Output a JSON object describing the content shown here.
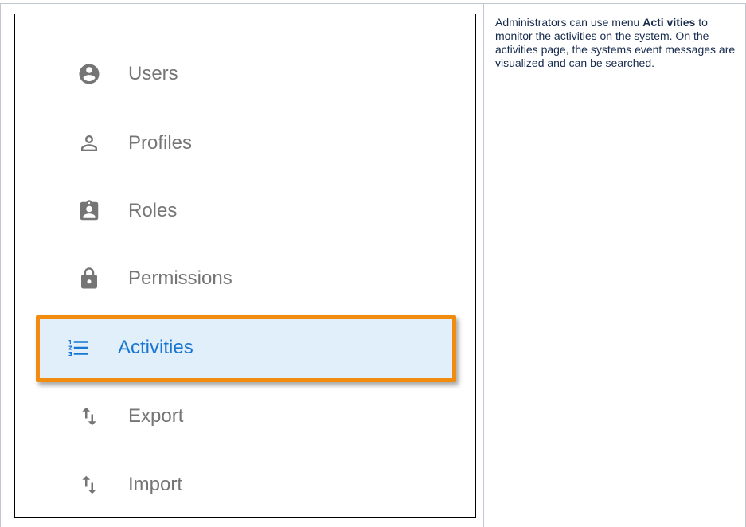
{
  "menu": {
    "items": [
      {
        "label": "Users",
        "icon": "account-circle-icon"
      },
      {
        "label": "Profiles",
        "icon": "person-outline-icon"
      },
      {
        "label": "Roles",
        "icon": "assignment-ind-icon"
      },
      {
        "label": "Permissions",
        "icon": "lock-icon"
      },
      {
        "label": "Activities",
        "icon": "format-list-numbered-icon",
        "active": true
      },
      {
        "label": "Export",
        "icon": "import-export-icon"
      },
      {
        "label": "Import",
        "icon": "import-export-icon"
      }
    ]
  },
  "description": {
    "before": "Administrators can use menu ",
    "bold": "Acti vities",
    "after": " to monitor the activities on the system. On the activities page, the systems event messages are visualized and can be searched."
  },
  "colors": {
    "highlight_border": "#f28c0f",
    "active_background": "#e1effa",
    "active_text": "#1976d2",
    "text_gray": "#757575"
  }
}
